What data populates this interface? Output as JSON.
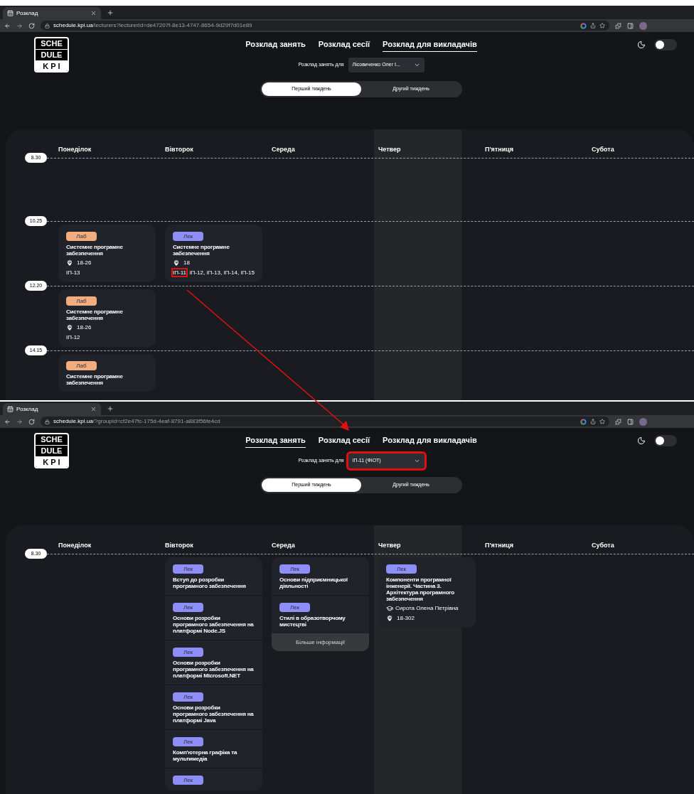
{
  "screens": [
    {
      "tab": {
        "title": "Розклад"
      },
      "url": {
        "host": "schedule.kpi.ua",
        "path": "/lecturers?lecturerId=de47207f-8e13-4747-8654-9d29f7d01e89"
      },
      "logo": [
        "SCHE",
        "DULE",
        "K P I"
      ],
      "nav": [
        {
          "label": "Розклад занять",
          "selected": false
        },
        {
          "label": "Розклад сесії",
          "selected": false
        },
        {
          "label": "Розклад для викладачів",
          "selected": true
        }
      ],
      "filter": {
        "label": "Розклад занять для",
        "value": "Лісовиченко Олег І...",
        "highlighted": false
      },
      "weeks": [
        {
          "label": "Перший тиждень",
          "selected": true
        },
        {
          "label": "Другий тиждень",
          "selected": false
        }
      ],
      "theme_toggle": {
        "on": false
      },
      "days": [
        {
          "name": "Понеділок",
          "highlighted": false
        },
        {
          "name": "Вівторок",
          "highlighted": false
        },
        {
          "name": "Середа",
          "highlighted": false
        },
        {
          "name": "Четвер",
          "highlighted": true
        },
        {
          "name": "П'ятниця",
          "highlighted": false
        },
        {
          "name": "Субота",
          "highlighted": false
        }
      ],
      "rows": [
        {
          "time": "8.30",
          "cells": [
            {},
            {},
            {},
            {},
            {},
            {}
          ]
        },
        {
          "time": "10.25",
          "cells": [
            {
              "lessons": [
                {
                  "type": "Лаб",
                  "kind": "lab",
                  "title": "Системне програмне забезпечення",
                  "room": "18-26",
                  "groups": [
                    {
                      "text": "ІП-13",
                      "highlighted": false
                    }
                  ]
                }
              ]
            },
            {
              "lessons": [
                {
                  "type": "Лек",
                  "kind": "lecture",
                  "title": "Системне програмне забезпечення",
                  "room": "18",
                  "groups": [
                    {
                      "text": "ІП-11",
                      "highlighted": true
                    },
                    {
                      "text": ", ІП-12, ІП-13, ІП-14, ІП-15",
                      "highlighted": false
                    }
                  ]
                }
              ]
            },
            {},
            {},
            {},
            {}
          ]
        },
        {
          "time": "12.20",
          "cells": [
            {
              "lessons": [
                {
                  "type": "Лаб",
                  "kind": "lab",
                  "title": "Системне програмне забезпечення",
                  "room": "18-26",
                  "groups": [
                    {
                      "text": "ІП-12",
                      "highlighted": false
                    }
                  ]
                }
              ]
            },
            {},
            {},
            {},
            {},
            {}
          ]
        },
        {
          "time": "14.15",
          "cells": [
            {
              "lessons": [
                {
                  "type": "Лаб",
                  "kind": "lab",
                  "title": "Системне програмне забезпечення"
                }
              ]
            },
            {},
            {},
            {},
            {},
            {}
          ]
        }
      ]
    },
    {
      "tab": {
        "title": "Розклад"
      },
      "url": {
        "host": "schedule.kpi.ua",
        "path": "/?groupId=cf2e47fc-175d-4eaf-8791-a883f56fe4cd"
      },
      "logo": [
        "SCHE",
        "DULE",
        "K P I"
      ],
      "nav": [
        {
          "label": "Розклад занять",
          "selected": true
        },
        {
          "label": "Розклад сесії",
          "selected": false
        },
        {
          "label": "Розклад для викладачів",
          "selected": false
        }
      ],
      "filter": {
        "label": "Розклад занять для",
        "value": "ІП-11 (ФІОТ)",
        "highlighted": true
      },
      "weeks": [
        {
          "label": "Перший тиждень",
          "selected": true
        },
        {
          "label": "Другий тиждень",
          "selected": false
        }
      ],
      "theme_toggle": {
        "on": false
      },
      "days": [
        {
          "name": "Понеділок",
          "highlighted": false
        },
        {
          "name": "Вівторок",
          "highlighted": false
        },
        {
          "name": "Середа",
          "highlighted": false
        },
        {
          "name": "Четвер",
          "highlighted": true
        },
        {
          "name": "П'ятниця",
          "highlighted": false
        },
        {
          "name": "Субота",
          "highlighted": false
        }
      ],
      "rows": [
        {
          "time": "8.30",
          "cells": [
            {},
            {
              "lessons": [
                {
                  "type": "Лек",
                  "kind": "lecture",
                  "title": "Вступ до розробки програмного забезпечення"
                },
                {
                  "type": "Лек",
                  "kind": "lecture",
                  "title": "Основи розробки програмного забезпечення на платформі Node.JS"
                },
                {
                  "type": "Лек",
                  "kind": "lecture",
                  "title": "Основи розробки програмного забезпечення на платформі Microsoft.NET"
                },
                {
                  "type": "Лек",
                  "kind": "lecture",
                  "title": "Основи розробки програмного забезпечення на платформі Java"
                },
                {
                  "type": "Лек",
                  "kind": "lecture",
                  "title": "Комп'ютерна графіка та мультимедіа"
                },
                {
                  "type": "Лек",
                  "kind": "lecture"
                }
              ]
            },
            {
              "lessons": [
                {
                  "type": "Лек",
                  "kind": "lecture",
                  "title": "Основи підприємницької діяльності"
                },
                {
                  "type": "Лек",
                  "kind": "lecture",
                  "title": "Стилі в образотворчому мистецтві"
                }
              ],
              "more": "Більше інформації"
            },
            {
              "lessons": [
                {
                  "type": "Лек",
                  "kind": "lecture",
                  "title": "Компоненти програмної інженерії. Частина 3. Архітектура програмного забезпечення",
                  "teacher": "Сирота Олена Петрівна",
                  "room": "18-302"
                }
              ]
            },
            {},
            {}
          ]
        }
      ]
    }
  ]
}
